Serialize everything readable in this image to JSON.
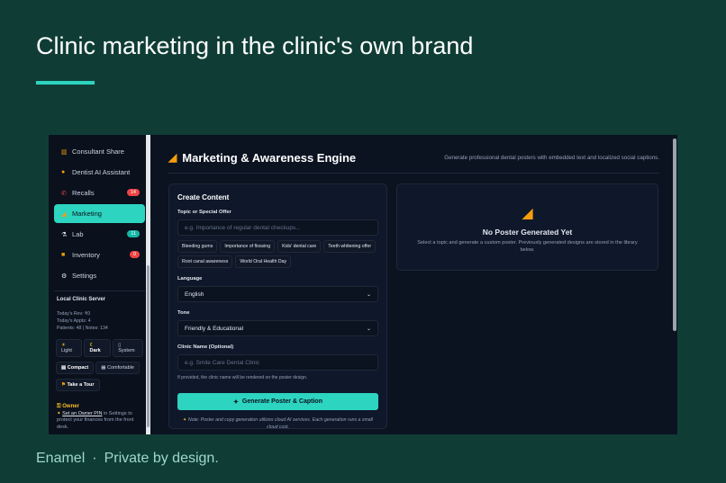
{
  "slide": {
    "title": "Clinic marketing in the clinic's own brand",
    "brand": "Enamel",
    "separator": "·",
    "tagline": "Private by design.",
    "accent": "#2dd4bf",
    "background": "#0f3d35"
  },
  "sidebar": {
    "items": [
      {
        "label": "Consultant Share",
        "icon": "chart-icon"
      },
      {
        "label": "Dentist AI Assistant",
        "icon": "assistant-icon"
      },
      {
        "label": "Recalls",
        "icon": "phone-icon",
        "badge": "14"
      },
      {
        "label": "Marketing",
        "icon": "megaphone-icon",
        "active": true
      },
      {
        "label": "Lab",
        "icon": "flask-icon",
        "badge": "11"
      },
      {
        "label": "Inventory",
        "icon": "box-icon",
        "badge": "0"
      },
      {
        "label": "Settings",
        "icon": "gear-icon"
      }
    ],
    "server_title": "Local Clinic Server",
    "stats": [
      "Today's Rev: ₹0",
      "Today's Appts: 4",
      "Patients: 48 | Notes: 134"
    ],
    "theme": {
      "light": "Light",
      "dark": "Dark",
      "system": "System"
    },
    "density": {
      "compact": "Compact",
      "comfortable": "Comfortable"
    },
    "tour": "Take a Tour",
    "owner": {
      "title": "Owner",
      "link": "Set an Owner PIN",
      "text_after": " in Settings to protect your finances from the front desk."
    }
  },
  "main": {
    "title": "Marketing & Awareness Engine",
    "subtitle": "Generate professional dental posters with embedded text and localized social captions.",
    "create": {
      "title": "Create Content",
      "topic_label": "Topic or Special Offer",
      "topic_placeholder": "e.g. Importance of regular dental checkups...",
      "chips": [
        "Bleeding gums",
        "Importance of flossing",
        "Kids' dental care",
        "Teeth whitening offer",
        "Root canal awareness",
        "World Oral Health Day"
      ],
      "language_label": "Language",
      "language_value": "English",
      "tone_label": "Tone",
      "tone_value": "Friendly & Educational",
      "clinic_label": "Clinic Name (Optional)",
      "clinic_placeholder": "e.g. Smile Care Dental Clinic",
      "clinic_hint": "If provided, the clinic name will be rendered on the poster design.",
      "generate_label": "Generate Poster & Caption",
      "note": "Note: Poster and copy generation utilizes cloud AI services. Each generation runs a small cloud cost."
    },
    "preview": {
      "title": "No Poster Generated Yet",
      "text": "Select a topic and generate a custom poster. Previously generated designs are stored in the library below."
    }
  }
}
